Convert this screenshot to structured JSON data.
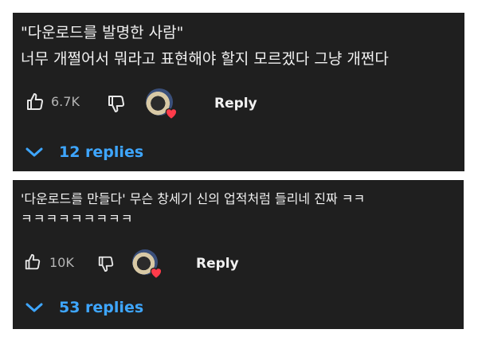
{
  "comments": [
    {
      "line1": "\"다운로드를 발명한 사람\"",
      "line2": "너무 개쩔어서 뭐라고 표현해야 할지 모르겠다 그냥 개쩐다",
      "likes": "6.7K",
      "reply_label": "Reply",
      "replies_label": "12 replies"
    },
    {
      "line1": "'다운로드를 만들다' 무슨 창세기 신의 업적처럼 들리네 진짜 ㅋㅋ",
      "line2": "ㅋㅋㅋㅋㅋㅋㅋㅋㅋ",
      "likes": "10K",
      "reply_label": "Reply",
      "replies_label": "53 replies"
    }
  ],
  "icons": {
    "like": "thumbs-up-icon",
    "dislike": "thumbs-down-icon",
    "creator_heart": "heart-icon",
    "expand": "chevron-down-icon"
  },
  "colors": {
    "card_bg": "#1f1f1f",
    "text": "#f1f1f1",
    "muted": "#b5b5b5",
    "link_blue": "#3ea6ff",
    "heart_red": "#ff3b4a"
  }
}
